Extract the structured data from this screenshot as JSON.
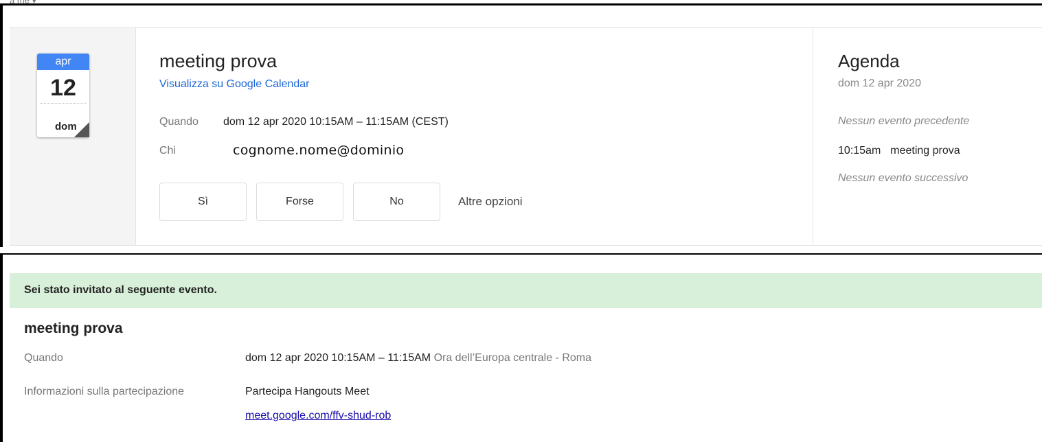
{
  "header": {
    "recipient_label": "a me"
  },
  "invite_card": {
    "calendar_icon": {
      "month": "apr",
      "day": "12",
      "weekday": "dom"
    },
    "event_title": "meeting prova",
    "calendar_link": "Visualizza su Google Calendar",
    "when_label": "Quando",
    "when_value": "dom 12 apr 2020 10:15AM – 11:15AM (CEST)",
    "who_label": "Chi",
    "who_value": "cognome.nome@dominio",
    "rsvp": {
      "yes": "Sì",
      "maybe": "Forse",
      "no": "No",
      "more": "Altre opzioni"
    }
  },
  "agenda": {
    "title": "Agenda",
    "date": "dom 12 apr 2020",
    "no_previous": "Nessun evento precedente",
    "event_time": "10:15am",
    "event_name": "meeting prova",
    "no_next": "Nessun evento successivo"
  },
  "invite_body": {
    "banner": "Sei stato invitato al seguente evento.",
    "title": "meeting prova",
    "when_label": "Quando",
    "when_value": "dom 12 apr 2020 10:15AM – 11:15AM",
    "timezone": "Ora dell’Europa centrale - Roma",
    "join_label": "Informazioni sulla partecipazione",
    "join_value": "Partecipa Hangouts Meet",
    "meet_link": "meet.google.com/ffv-shud-rob"
  },
  "colors": {
    "calendar_blue": "#4285f4",
    "link_blue": "#1a66d8",
    "banner_green": "#d8f0d9"
  }
}
